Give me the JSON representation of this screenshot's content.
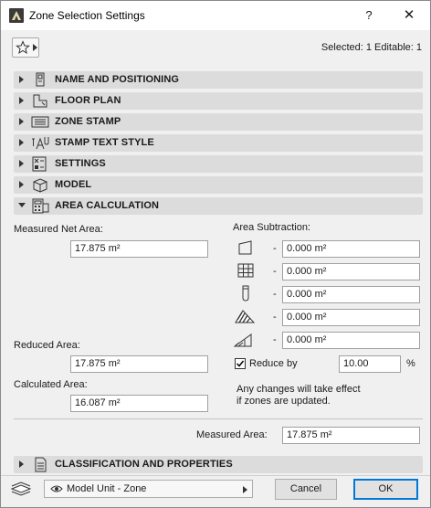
{
  "window": {
    "title": "Zone Selection Settings",
    "help_label": "?",
    "close_label": "✕"
  },
  "header": {
    "selected_info": "Selected: 1 Editable: 1"
  },
  "panels": [
    {
      "label": "NAME AND POSITIONING",
      "expanded": false,
      "icon": "name-positioning-icon"
    },
    {
      "label": "FLOOR PLAN",
      "expanded": false,
      "icon": "floor-plan-icon"
    },
    {
      "label": "ZONE STAMP",
      "expanded": false,
      "icon": "zone-stamp-icon"
    },
    {
      "label": "STAMP TEXT STYLE",
      "expanded": false,
      "icon": "stamp-text-style-icon"
    },
    {
      "label": "SETTINGS",
      "expanded": false,
      "icon": "settings-icon"
    },
    {
      "label": "MODEL",
      "expanded": false,
      "icon": "model-icon"
    },
    {
      "label": "AREA CALCULATION",
      "expanded": true,
      "icon": "area-calculation-icon"
    },
    {
      "label": "CLASSIFICATION AND PROPERTIES",
      "expanded": false,
      "icon": "classification-icon"
    }
  ],
  "area": {
    "measured_net_label": "Measured Net Area:",
    "measured_net_value": "17.875 m²",
    "subtraction_label": "Area Subtraction:",
    "subtractions": [
      {
        "icon": "wall-subtraction-icon",
        "dash": "-",
        "value": "0.000 m²"
      },
      {
        "icon": "curtain-wall-subtraction-icon",
        "dash": "-",
        "value": "0.000 m²"
      },
      {
        "icon": "column-subtraction-icon",
        "dash": "-",
        "value": "0.000 m²"
      },
      {
        "icon": "fill-subtraction-icon",
        "dash": "-",
        "value": "0.000 m²"
      },
      {
        "icon": "low-height-subtraction-icon",
        "dash": "-",
        "value": "0.000 m²"
      }
    ],
    "reduced_label": "Reduced Area:",
    "reduced_value": "17.875 m²",
    "reduce_by_label": "Reduce by",
    "reduce_by_checked": true,
    "reduce_by_value": "10.00",
    "reduce_by_unit": "%",
    "calculated_label": "Calculated Area:",
    "calculated_value": "16.087 m²",
    "note_line1": "Any changes will take effect",
    "note_line2": "if zones are updated.",
    "measured_label": "Measured Area:",
    "measured_value": "17.875 m²"
  },
  "footer": {
    "unit_select": "Model Unit - Zone",
    "cancel_label": "Cancel",
    "ok_label": "OK"
  }
}
